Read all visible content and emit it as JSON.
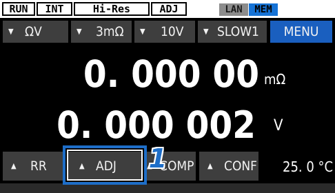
{
  "status_bar": {
    "run": "RUN",
    "int": "INT",
    "hi_res": "Hi-Res",
    "adj": "ADJ",
    "lan": "LAN",
    "mem": "MEM"
  },
  "top_buttons": {
    "range": "ΩV",
    "resistance_range": "3mΩ",
    "voltage_range": "10V",
    "speed": "SLOW1",
    "menu": "MENU"
  },
  "readings": {
    "resistance_value": "0. 000 00",
    "resistance_unit": "mΩ",
    "voltage_value": "0. 000 002",
    "voltage_unit": "V"
  },
  "bottom_buttons": {
    "rr": "RR",
    "adj": "ADJ",
    "comp": "COMP",
    "conf": "CONF"
  },
  "temperature": "25. 0 °C",
  "callout": {
    "number": "1"
  },
  "icons": {
    "down_arrow": "▼",
    "up_arrow": "▲"
  },
  "colors": {
    "button_bg": "#3e3e3e",
    "menu_bg": "#1a5fbf",
    "mem_indicator": "#1673d6",
    "lan_indicator": "#8c8c8c",
    "callout": "#1e6ec8"
  }
}
